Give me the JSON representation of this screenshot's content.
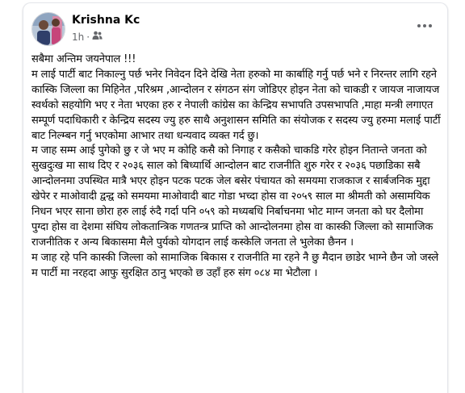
{
  "post": {
    "author": "Krishna Kc",
    "time": "1h",
    "separator": "·",
    "privacy_icon": "friends-icon",
    "more_icon": "more-options-icon",
    "body": "सबैमा अन्तिम  जयनेपाल !!!\n म लाई पार्टी बाट निकाल्नु पर्छ भनेर निवेदन दिने देखि नेता हरुको मा कार्बाहि गर्नु पर्छ भने र निरन्तर लागि रहने कास्कि जिल्ला का मिहिनेत ,परिश्रम ,आन्दोलन र संगठन संग जोडिएर होइन नेता को चाकडी र जायज नाजायज स्वर्थको सहयोगि भए र नेता भएका हरु र नेपाली कांग्रेस का केन्द्रिय सभापति उपसभापति ,माहा मन्त्री लगाएत सम्पूर्ण पदाधिकारी र केन्द्रिय सदस्य ज्यु हरु साथै अनुशासन समिति का संयोजक र सदस्य ज्यु हरुमा मलाई पार्टी बाट निल्म्बन गर्नु भएकोमा आभार तथा धन्यवाद व्यक्त गर्द छु।\nम जाह सम्म आई पुगेको छु र जे भए म कोहि कसै को निगाह र कसैको चाकडि गरेर होइन नितान्ते जनता को सुखदुःख मा साथ दिए र २०३६ साल को बिध्यार्थि आन्दोलन बाट राजनीति शुरु गरेर र २०३६ पछाडिका सबै आन्दोलनमा उपस्थित मात्रै भएर होइन पटक पटक  जेल बसेर  पंचायत को समयमा राजकाज र सार्बजनिक मुद्दा खेपेर र माओवादी द्वन्द्व को समयमा माओवादी बाट गोडा भच्दा होस वा २०५९ साल मा श्रीमती को असामयिक निधन भएर साना छोरा हरु लाई रुंदै गर्दा पनि ०५९ को मध्यबधि निर्बाचनमा भोट माग्न जनता को घर दैलोमा पुग्दा होस वा देशमा संघिय लोकतान्त्रिक गणतन्त्र प्राप्ति को आन्दोलनमा होस वा कास्की जिल्ला को सामाजिक राजनीतिक र अन्य बिकासमा मैले पुर्यको योगदान लाई कस्केलि जनता ले भुलेका छैनन ।\nम जाह रहे पनि कास्की जिल्ला को सामाजिक बिकास र राजनीति मा रहने नै छु मैदान छाडेर भाग्ने छैन जो जस्ले म पार्टी मा नरहदा आफु सुरक्षित ठानु भएको छ उहाँ हरु संग ०८४ मा भेटौला ।",
    "colors": {
      "text": "#050505",
      "meta": "#65676b",
      "border": "#e4e6eb"
    }
  }
}
